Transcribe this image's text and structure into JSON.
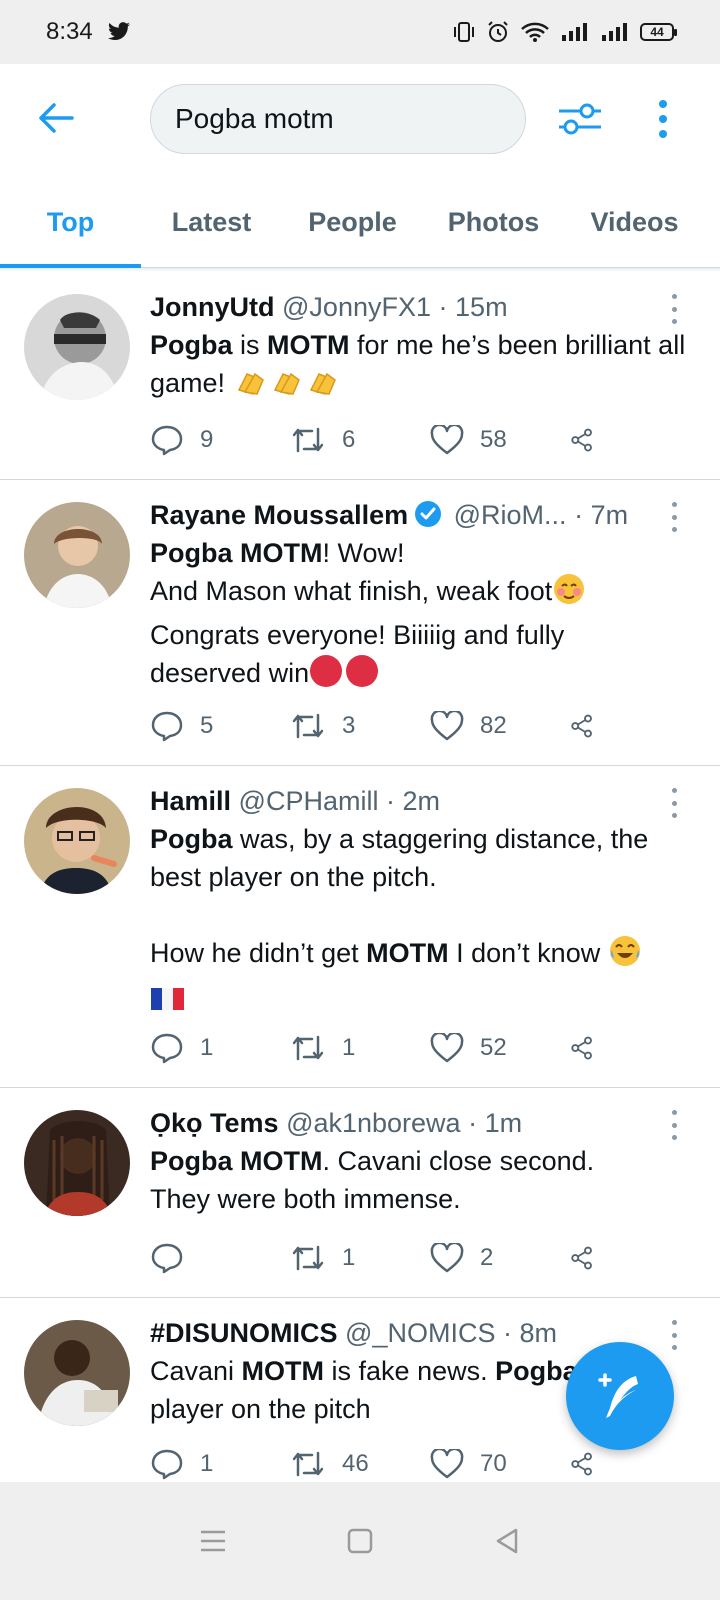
{
  "status_bar": {
    "time": "8:34",
    "battery": "44"
  },
  "search": {
    "query": "Pogba motm"
  },
  "tabs": [
    {
      "label": "Top",
      "active": true
    },
    {
      "label": "Latest",
      "active": false
    },
    {
      "label": "People",
      "active": false
    },
    {
      "label": "Photos",
      "active": false
    },
    {
      "label": "Videos",
      "active": false
    }
  ],
  "tweets": [
    {
      "name": "JonnyUtd",
      "handle": "@JonnyFX1",
      "time": "15m",
      "verified": false,
      "text_parts": [
        "Pogba",
        " is ",
        "MOTM",
        " for me he’s been brilliant all game! "
      ],
      "replies": "9",
      "retweets": "6",
      "likes": "58"
    },
    {
      "name": "Rayane Moussallem",
      "handle": "@RioM...",
      "time": "7m",
      "verified": true,
      "text_parts": [
        "Pogba MOTM",
        "! Wow!",
        "And Mason what finish, weak foot",
        "Congrats everyone! Biiiiig and fully",
        "deserved win"
      ],
      "replies": "5",
      "retweets": "3",
      "likes": "82"
    },
    {
      "name": "Hamill",
      "handle": "@CPHamill",
      "time": "2m",
      "verified": false,
      "text_parts": [
        "Pogba",
        " was, by a staggering distance, the best player on the pitch.",
        "How he didn’t get ",
        "MOTM",
        " I don’t know "
      ],
      "replies": "1",
      "retweets": "1",
      "likes": "52"
    },
    {
      "name": "Ọkọ Tems",
      "handle": "@ak1nborewa",
      "time": "1m",
      "verified": false,
      "text_parts": [
        "Pogba MOTM",
        ". Cavani close second.",
        "They were both immense."
      ],
      "replies": "",
      "retweets": "1",
      "likes": "2"
    },
    {
      "name": "#DISUNOMICS",
      "handle": "@_NOMICS",
      "time": "8m",
      "verified": false,
      "text_parts": [
        "Cavani ",
        "MOTM",
        " is fake news. ",
        "Pogba",
        "player on the pitch"
      ],
      "replies": "1",
      "retweets": "46",
      "likes": "70"
    }
  ],
  "colors": {
    "accent": "#1d9bf0",
    "secondary_text": "#536471",
    "divider": "#cfd9de"
  },
  "icons": [
    "back-arrow-icon",
    "filter-icon",
    "more-vertical-icon",
    "reply-icon",
    "retweet-icon",
    "like-icon",
    "share-icon",
    "compose-icon",
    "verified-icon"
  ]
}
